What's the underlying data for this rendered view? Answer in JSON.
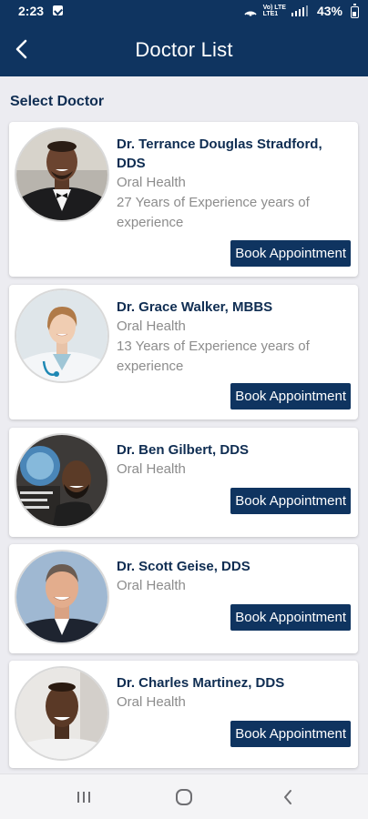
{
  "status_bar": {
    "time": "2:23",
    "network_label": "Vo) LTE\nLTE1",
    "battery": "43%"
  },
  "header": {
    "title": "Doctor List",
    "back_icon": "chevron-left-icon"
  },
  "section_label": "Select Doctor",
  "book_label": "Book Appointment",
  "doctors": [
    {
      "name": "Dr. Terrance Douglas Stradford, DDS",
      "specialty": "Oral Health",
      "experience": "27 Years of Experience years of experience"
    },
    {
      "name": "Dr. Grace Walker, MBBS",
      "specialty": "Oral Health",
      "experience": "13 Years of Experience years of experience"
    },
    {
      "name": "Dr. Ben Gilbert, DDS",
      "specialty": "Oral Health",
      "experience": ""
    },
    {
      "name": "Dr. Scott Geise, DDS",
      "specialty": "Oral Health",
      "experience": ""
    },
    {
      "name": "Dr. Charles Martinez, DDS",
      "specialty": "Oral Health",
      "experience": ""
    }
  ],
  "nav": {
    "recents_icon": "recents-icon",
    "home_icon": "home-icon",
    "back_icon": "back-icon"
  },
  "colors": {
    "primary": "#0f3460",
    "name_text": "#0f2d52",
    "secondary_text": "#8c8c8c",
    "background": "#ececf1"
  }
}
